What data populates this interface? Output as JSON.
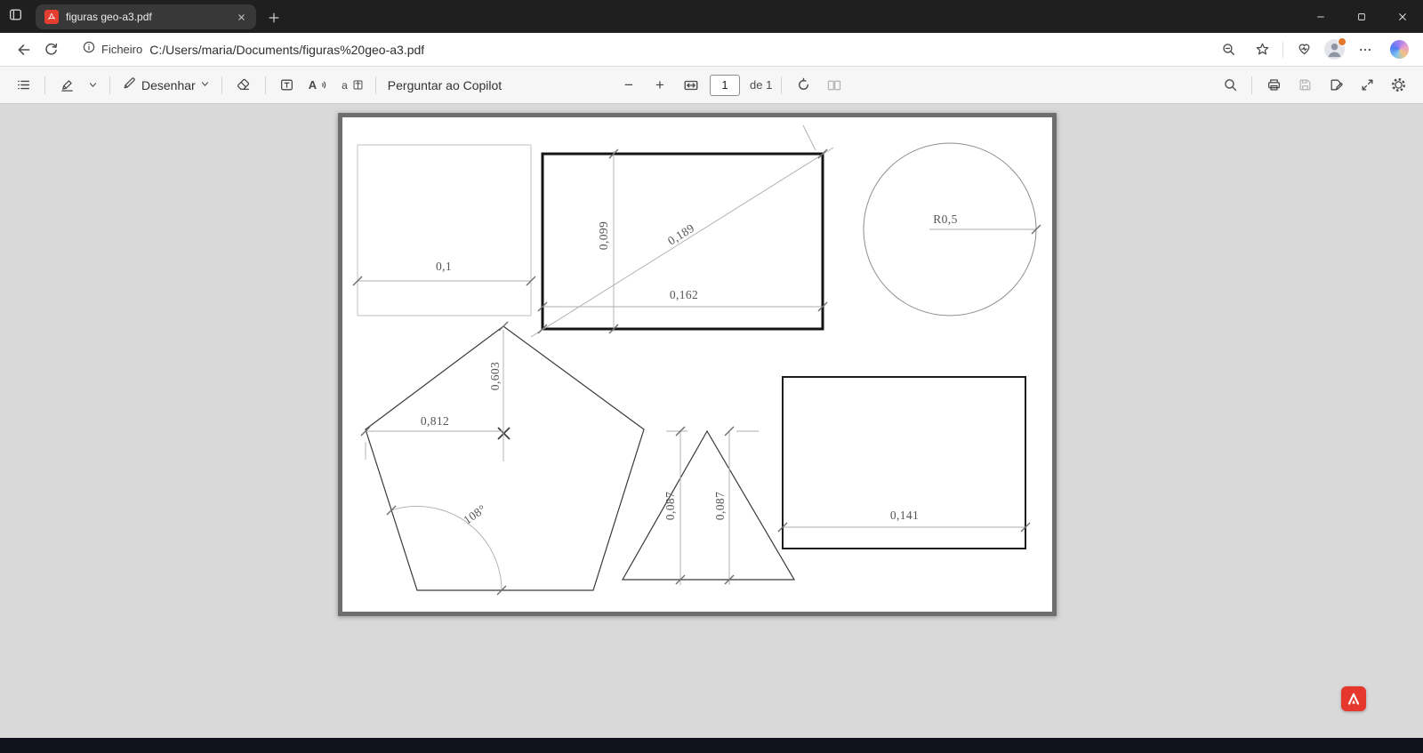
{
  "titlebar": {
    "tab_title": "figuras geo-a3.pdf"
  },
  "navbar": {
    "security_label": "Ficheiro",
    "url": "C:/Users/maria/Documents/figuras%20geo-a3.pdf"
  },
  "pdf_toolbar": {
    "draw_label": "Desenhar",
    "ask_copilot_label": "Perguntar ao Copilot",
    "page_number": "1",
    "page_total": "de 1"
  },
  "icons": {
    "zoom_out": "−",
    "zoom_in": "+",
    "read_aloud": "A",
    "translate": "a"
  },
  "drawing": {
    "dimensions": {
      "small_rect_width": "0,1",
      "bold_rect_height": "0,099",
      "bold_rect_diagonal": "0,189",
      "bold_rect_width": "0,162",
      "circle_radius": "R0,5",
      "pentagon_vertical": "0,603",
      "pentagon_horizontal": "0,812",
      "pentagon_angle": "108°",
      "triangle_left": "0,087",
      "triangle_right": "0,087",
      "rect_width": "0,141"
    }
  }
}
